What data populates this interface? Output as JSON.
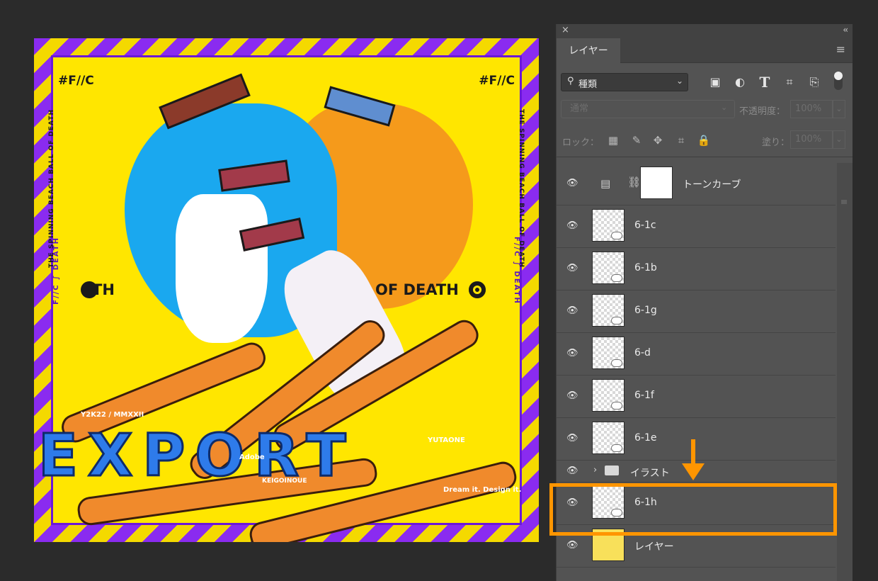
{
  "artwork": {
    "tag_left": "#F//C",
    "tag_right": "#F//C",
    "vertical_text": "THE SPINNING BEACH BALL OF DEATH",
    "side_text": "F//C ∫ DEATH",
    "band_left": "TH",
    "band_right": "OF DEATH",
    "logo_title": "EXPORT",
    "logo_year": "Y2K22 / MMXXII",
    "logo_adobe": "Adobe",
    "logo_keigo": "KEIGOINOUE",
    "logo_yuta": "YUTAONE",
    "logo_dream": "Dream it. Design it."
  },
  "panel": {
    "close_icon": "×",
    "collapse_icon": "‹‹",
    "tab_label": "レイヤー",
    "menu_icon": "≡",
    "filter": {
      "search_icon": "⚲",
      "kind_label": "種類",
      "chevron": "⌄",
      "image_icon": "▣",
      "adjust_icon": "◐",
      "type_icon": "T",
      "shape_icon": "⌗",
      "smart_icon": "⎘"
    },
    "blend_mode": "通常",
    "blend_chevron": "⌄",
    "opacity_label": "不透明度：",
    "opacity_value": "100%",
    "value_chevron": "⌄",
    "lock_label": "ロック：",
    "lock_icons": {
      "pixels": "▦",
      "brush": "✎",
      "move": "✥",
      "artboard": "⌗",
      "all": "🔒"
    },
    "fill_label": "塗り：",
    "fill_value": "100%",
    "eye_icon": "👁",
    "adjustment_layer": {
      "icon": "▤",
      "link_icon": "⛓",
      "name": "トーンカーブ"
    },
    "layers": [
      {
        "name": "6-1c"
      },
      {
        "name": "6-1b"
      },
      {
        "name": "6-1g"
      },
      {
        "name": "6-d"
      },
      {
        "name": "6-1f"
      },
      {
        "name": "6-1e"
      }
    ],
    "group": {
      "chevron": "›",
      "name": "イラスト"
    },
    "selected_layer": {
      "name": "6-1h"
    },
    "bottom_layer": {
      "name": "レイヤー"
    }
  },
  "colors": {
    "panel_bg": "#535353",
    "highlight": "#ff9500",
    "canvas_bg": "#2b2b2b"
  }
}
